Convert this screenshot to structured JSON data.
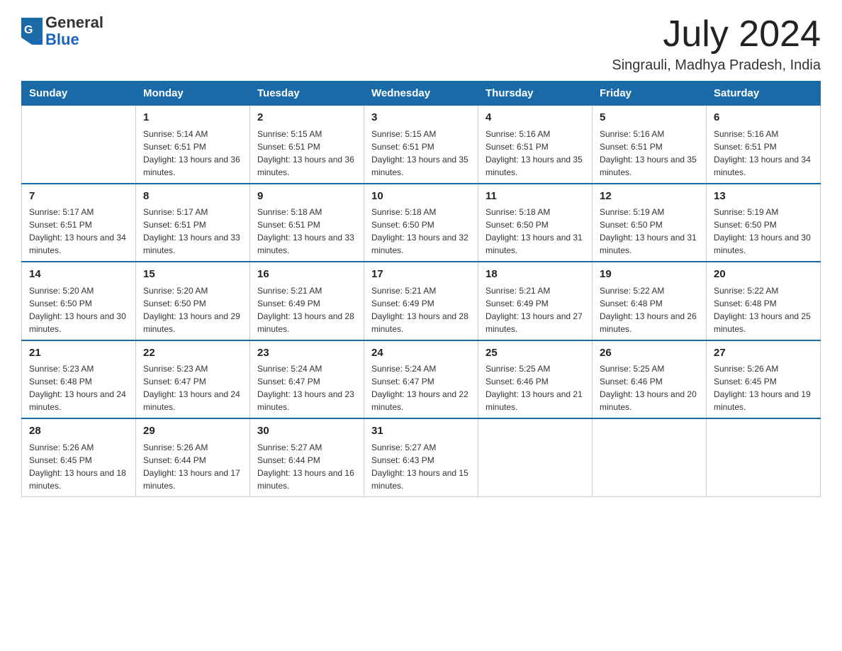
{
  "header": {
    "logo_general": "General",
    "logo_blue": "Blue",
    "month_title": "July 2024",
    "location": "Singrauli, Madhya Pradesh, India"
  },
  "columns": [
    "Sunday",
    "Monday",
    "Tuesday",
    "Wednesday",
    "Thursday",
    "Friday",
    "Saturday"
  ],
  "weeks": [
    [
      {
        "day": "",
        "sunrise": "",
        "sunset": "",
        "daylight": ""
      },
      {
        "day": "1",
        "sunrise": "Sunrise: 5:14 AM",
        "sunset": "Sunset: 6:51 PM",
        "daylight": "Daylight: 13 hours and 36 minutes."
      },
      {
        "day": "2",
        "sunrise": "Sunrise: 5:15 AM",
        "sunset": "Sunset: 6:51 PM",
        "daylight": "Daylight: 13 hours and 36 minutes."
      },
      {
        "day": "3",
        "sunrise": "Sunrise: 5:15 AM",
        "sunset": "Sunset: 6:51 PM",
        "daylight": "Daylight: 13 hours and 35 minutes."
      },
      {
        "day": "4",
        "sunrise": "Sunrise: 5:16 AM",
        "sunset": "Sunset: 6:51 PM",
        "daylight": "Daylight: 13 hours and 35 minutes."
      },
      {
        "day": "5",
        "sunrise": "Sunrise: 5:16 AM",
        "sunset": "Sunset: 6:51 PM",
        "daylight": "Daylight: 13 hours and 35 minutes."
      },
      {
        "day": "6",
        "sunrise": "Sunrise: 5:16 AM",
        "sunset": "Sunset: 6:51 PM",
        "daylight": "Daylight: 13 hours and 34 minutes."
      }
    ],
    [
      {
        "day": "7",
        "sunrise": "Sunrise: 5:17 AM",
        "sunset": "Sunset: 6:51 PM",
        "daylight": "Daylight: 13 hours and 34 minutes."
      },
      {
        "day": "8",
        "sunrise": "Sunrise: 5:17 AM",
        "sunset": "Sunset: 6:51 PM",
        "daylight": "Daylight: 13 hours and 33 minutes."
      },
      {
        "day": "9",
        "sunrise": "Sunrise: 5:18 AM",
        "sunset": "Sunset: 6:51 PM",
        "daylight": "Daylight: 13 hours and 33 minutes."
      },
      {
        "day": "10",
        "sunrise": "Sunrise: 5:18 AM",
        "sunset": "Sunset: 6:50 PM",
        "daylight": "Daylight: 13 hours and 32 minutes."
      },
      {
        "day": "11",
        "sunrise": "Sunrise: 5:18 AM",
        "sunset": "Sunset: 6:50 PM",
        "daylight": "Daylight: 13 hours and 31 minutes."
      },
      {
        "day": "12",
        "sunrise": "Sunrise: 5:19 AM",
        "sunset": "Sunset: 6:50 PM",
        "daylight": "Daylight: 13 hours and 31 minutes."
      },
      {
        "day": "13",
        "sunrise": "Sunrise: 5:19 AM",
        "sunset": "Sunset: 6:50 PM",
        "daylight": "Daylight: 13 hours and 30 minutes."
      }
    ],
    [
      {
        "day": "14",
        "sunrise": "Sunrise: 5:20 AM",
        "sunset": "Sunset: 6:50 PM",
        "daylight": "Daylight: 13 hours and 30 minutes."
      },
      {
        "day": "15",
        "sunrise": "Sunrise: 5:20 AM",
        "sunset": "Sunset: 6:50 PM",
        "daylight": "Daylight: 13 hours and 29 minutes."
      },
      {
        "day": "16",
        "sunrise": "Sunrise: 5:21 AM",
        "sunset": "Sunset: 6:49 PM",
        "daylight": "Daylight: 13 hours and 28 minutes."
      },
      {
        "day": "17",
        "sunrise": "Sunrise: 5:21 AM",
        "sunset": "Sunset: 6:49 PM",
        "daylight": "Daylight: 13 hours and 28 minutes."
      },
      {
        "day": "18",
        "sunrise": "Sunrise: 5:21 AM",
        "sunset": "Sunset: 6:49 PM",
        "daylight": "Daylight: 13 hours and 27 minutes."
      },
      {
        "day": "19",
        "sunrise": "Sunrise: 5:22 AM",
        "sunset": "Sunset: 6:48 PM",
        "daylight": "Daylight: 13 hours and 26 minutes."
      },
      {
        "day": "20",
        "sunrise": "Sunrise: 5:22 AM",
        "sunset": "Sunset: 6:48 PM",
        "daylight": "Daylight: 13 hours and 25 minutes."
      }
    ],
    [
      {
        "day": "21",
        "sunrise": "Sunrise: 5:23 AM",
        "sunset": "Sunset: 6:48 PM",
        "daylight": "Daylight: 13 hours and 24 minutes."
      },
      {
        "day": "22",
        "sunrise": "Sunrise: 5:23 AM",
        "sunset": "Sunset: 6:47 PM",
        "daylight": "Daylight: 13 hours and 24 minutes."
      },
      {
        "day": "23",
        "sunrise": "Sunrise: 5:24 AM",
        "sunset": "Sunset: 6:47 PM",
        "daylight": "Daylight: 13 hours and 23 minutes."
      },
      {
        "day": "24",
        "sunrise": "Sunrise: 5:24 AM",
        "sunset": "Sunset: 6:47 PM",
        "daylight": "Daylight: 13 hours and 22 minutes."
      },
      {
        "day": "25",
        "sunrise": "Sunrise: 5:25 AM",
        "sunset": "Sunset: 6:46 PM",
        "daylight": "Daylight: 13 hours and 21 minutes."
      },
      {
        "day": "26",
        "sunrise": "Sunrise: 5:25 AM",
        "sunset": "Sunset: 6:46 PM",
        "daylight": "Daylight: 13 hours and 20 minutes."
      },
      {
        "day": "27",
        "sunrise": "Sunrise: 5:26 AM",
        "sunset": "Sunset: 6:45 PM",
        "daylight": "Daylight: 13 hours and 19 minutes."
      }
    ],
    [
      {
        "day": "28",
        "sunrise": "Sunrise: 5:26 AM",
        "sunset": "Sunset: 6:45 PM",
        "daylight": "Daylight: 13 hours and 18 minutes."
      },
      {
        "day": "29",
        "sunrise": "Sunrise: 5:26 AM",
        "sunset": "Sunset: 6:44 PM",
        "daylight": "Daylight: 13 hours and 17 minutes."
      },
      {
        "day": "30",
        "sunrise": "Sunrise: 5:27 AM",
        "sunset": "Sunset: 6:44 PM",
        "daylight": "Daylight: 13 hours and 16 minutes."
      },
      {
        "day": "31",
        "sunrise": "Sunrise: 5:27 AM",
        "sunset": "Sunset: 6:43 PM",
        "daylight": "Daylight: 13 hours and 15 minutes."
      },
      {
        "day": "",
        "sunrise": "",
        "sunset": "",
        "daylight": ""
      },
      {
        "day": "",
        "sunrise": "",
        "sunset": "",
        "daylight": ""
      },
      {
        "day": "",
        "sunrise": "",
        "sunset": "",
        "daylight": ""
      }
    ]
  ]
}
